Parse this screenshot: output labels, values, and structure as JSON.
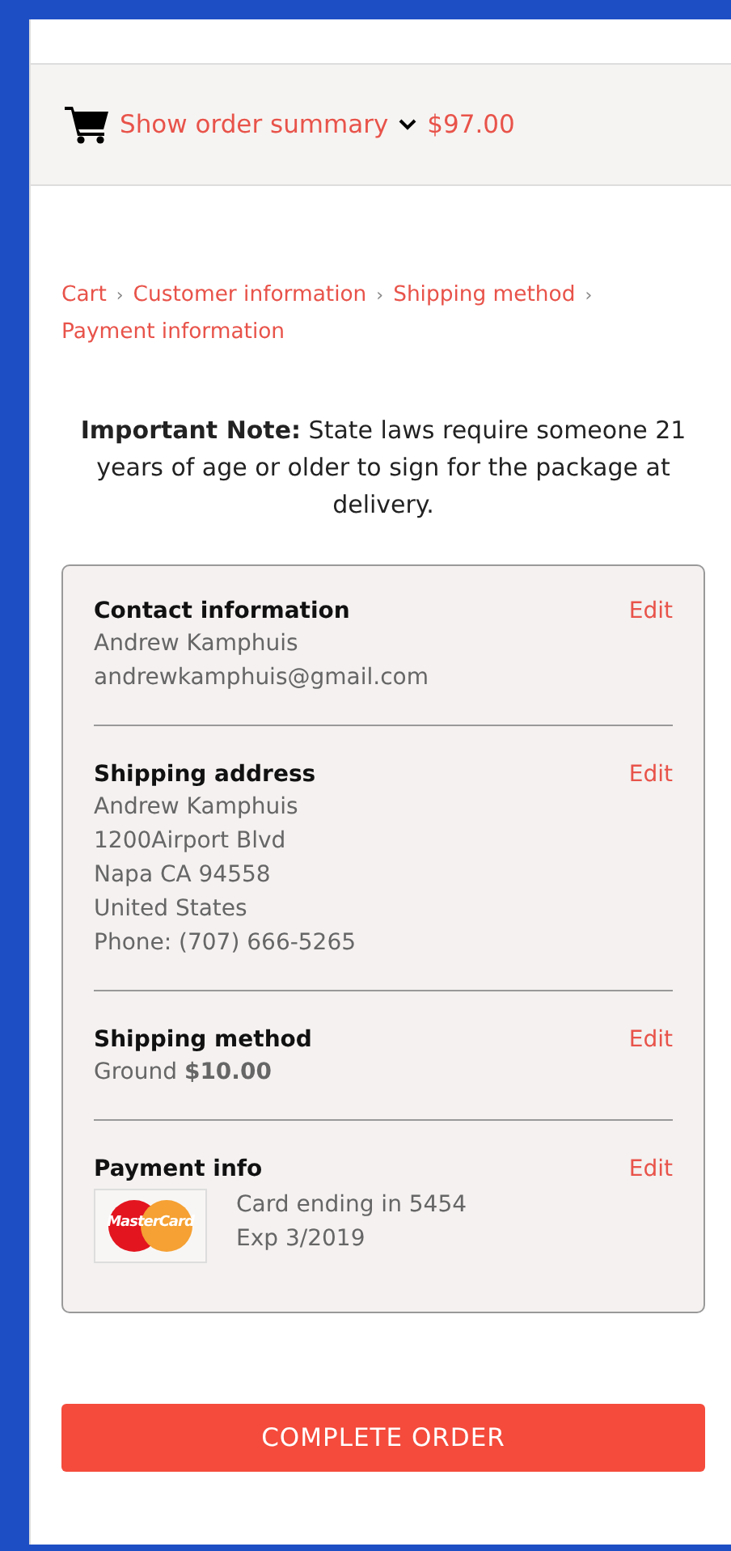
{
  "order_summary": {
    "label": "Show order summary",
    "total": "$97.00"
  },
  "breadcrumbs": [
    {
      "label": "Cart"
    },
    {
      "label": "Customer information"
    },
    {
      "label": "Shipping method"
    },
    {
      "label": "Payment information"
    }
  ],
  "breadcrumb_separator": "›",
  "note": "**Important Note:** State laws require someone 21 years of age or older to sign for the package at delivery.",
  "review_sections": [
    {
      "kind": "text",
      "title": "Contact information",
      "edit": "Edit",
      "lines": [
        "Andrew Kamphuis",
        "andrewkamphuis@gmail.com"
      ]
    },
    {
      "kind": "text",
      "title": "Shipping address",
      "edit": "Edit",
      "lines": [
        "Andrew Kamphuis",
        "1200Airport Blvd",
        "Napa CA 94558",
        "United States",
        "Phone: (707) 666-5265"
      ]
    },
    {
      "kind": "text",
      "title": "Shipping method",
      "edit": "Edit",
      "lines": [
        "Ground  **$10.00**"
      ]
    },
    {
      "kind": "payment",
      "title": "Payment info",
      "edit": "Edit",
      "card_brand": "MasterCard",
      "lines": [
        "Card ending in 5454",
        "Exp 3/2019"
      ]
    }
  ],
  "complete_button": "COMPLETE ORDER"
}
